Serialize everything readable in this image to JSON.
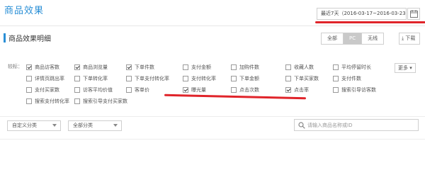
{
  "page": {
    "title": "商品效果"
  },
  "date_range": {
    "label": "最近7天（2016-03-17~2016-03-23）"
  },
  "section": {
    "title": "商品效果明细"
  },
  "device_tabs": [
    {
      "label": "全部",
      "active": false
    },
    {
      "label": "PC",
      "active": true
    },
    {
      "label": "无线",
      "active": false
    }
  ],
  "download": {
    "label": "下载"
  },
  "metrics": {
    "label": "较标：",
    "more_label": "更多",
    "rows": [
      [
        {
          "label": "商品访客数",
          "checked": true
        },
        {
          "label": "商品浏览量",
          "checked": true
        },
        {
          "label": "下单件数",
          "checked": true
        },
        {
          "label": "支付金额",
          "checked": false
        },
        {
          "label": "加购件数",
          "checked": false
        },
        {
          "label": "收藏人数",
          "checked": false
        },
        {
          "label": "平均停留时长",
          "checked": false
        }
      ],
      [
        {
          "label": "详情页跳出率",
          "checked": false
        },
        {
          "label": "下单转化率",
          "checked": false
        },
        {
          "label": "下单支付转化率",
          "checked": false
        },
        {
          "label": "支付转化率",
          "checked": false
        },
        {
          "label": "下单金额",
          "checked": false
        },
        {
          "label": "下单买家数",
          "checked": false
        },
        {
          "label": "支付件数",
          "checked": false
        }
      ],
      [
        {
          "label": "支付买家数",
          "checked": false
        },
        {
          "label": "访客平均价值",
          "checked": false
        },
        {
          "label": "客单价",
          "checked": false
        },
        {
          "label": "曝光量",
          "checked": true
        },
        {
          "label": "点击次数",
          "checked": false
        },
        {
          "label": "点击率",
          "checked": true
        },
        {
          "label": "搜索引导访客数",
          "checked": false
        }
      ],
      [
        {
          "label": "搜索支付转化率",
          "checked": false
        },
        {
          "label": "搜索引导支付买家数",
          "checked": false
        }
      ]
    ]
  },
  "filters": {
    "category_label": "自定义分类",
    "all_category_label": "全部分类",
    "search_placeholder": "请输入商品名称或ID"
  },
  "colors": {
    "accent": "#2a8fd6",
    "annotation_red": "#e0242a"
  }
}
